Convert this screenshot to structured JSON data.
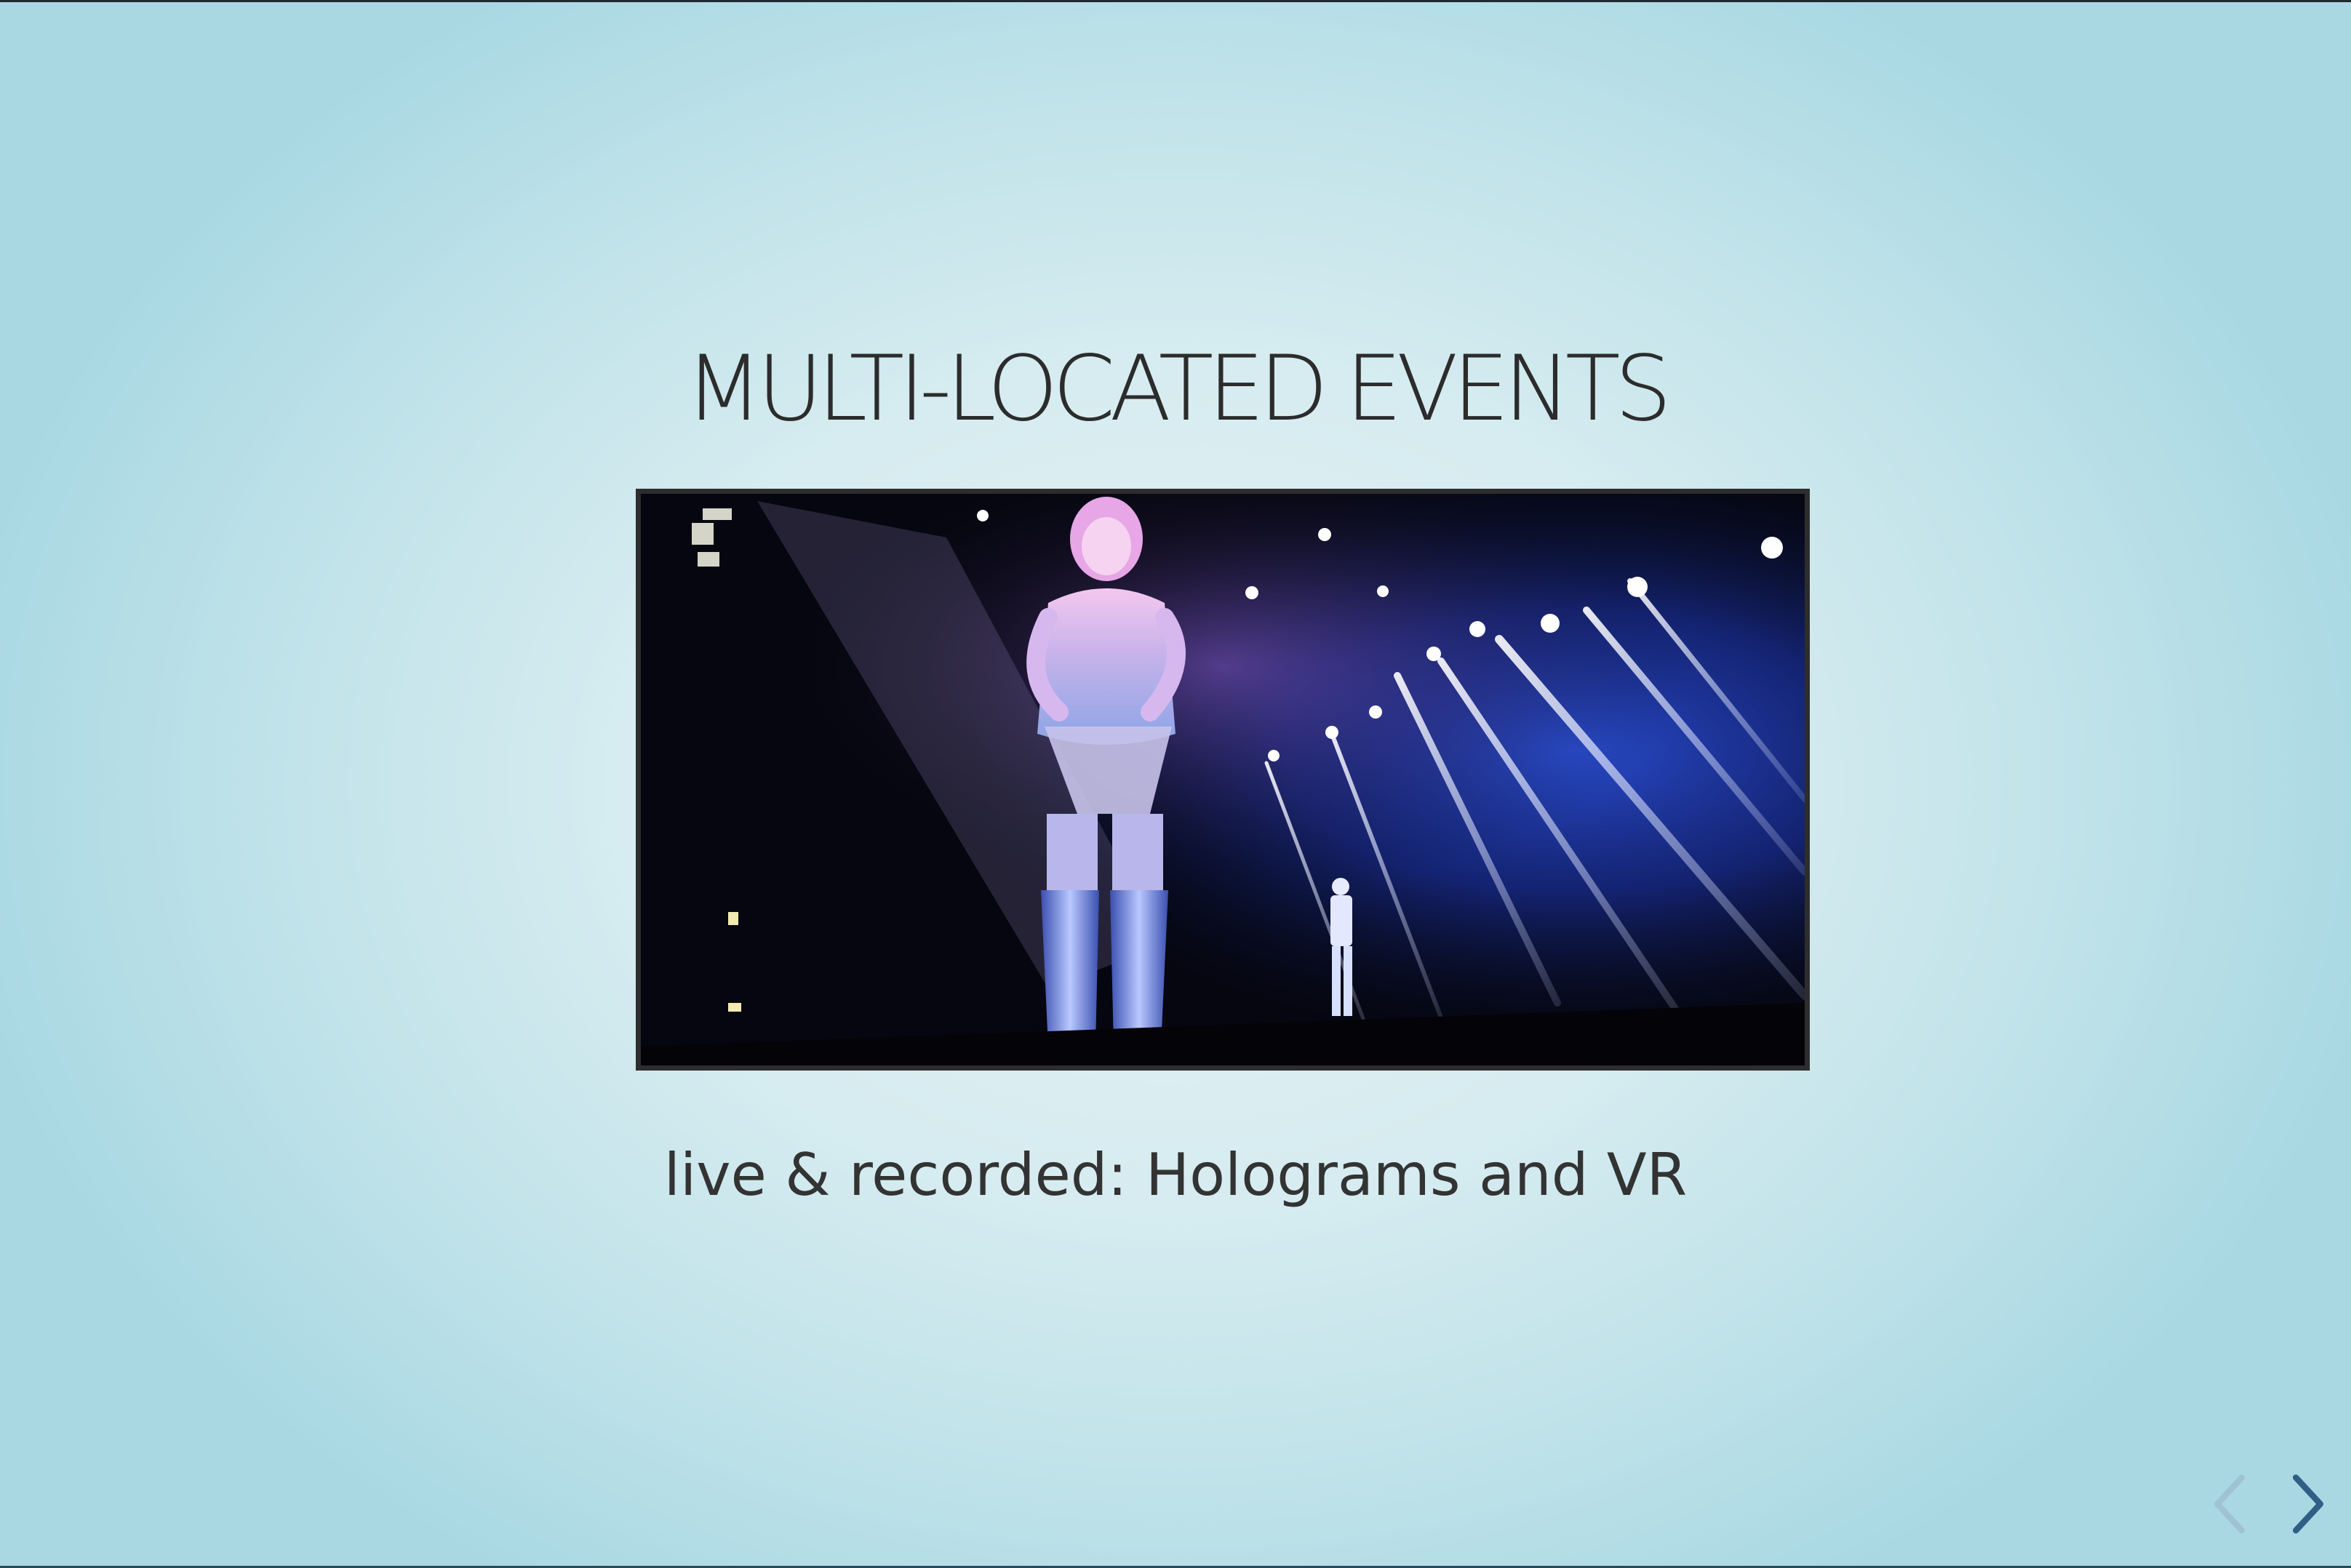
{
  "slide": {
    "title": "MULTI-LOCATED EVENTS",
    "subtitle": "live & recorded: Holograms and VR",
    "image_alt": "Giant hologram of a performer on stage next to a presenter under blue stage lights"
  },
  "navigation": {
    "prev_icon": "chevron-left-icon",
    "next_icon": "chevron-right-icon",
    "prev_enabled": false,
    "next_enabled": true
  },
  "colors": {
    "title": "#2c2c2c",
    "subtitle": "#333333",
    "nav_active": "#2f5f86",
    "nav_disabled": "#9fc3d3"
  }
}
